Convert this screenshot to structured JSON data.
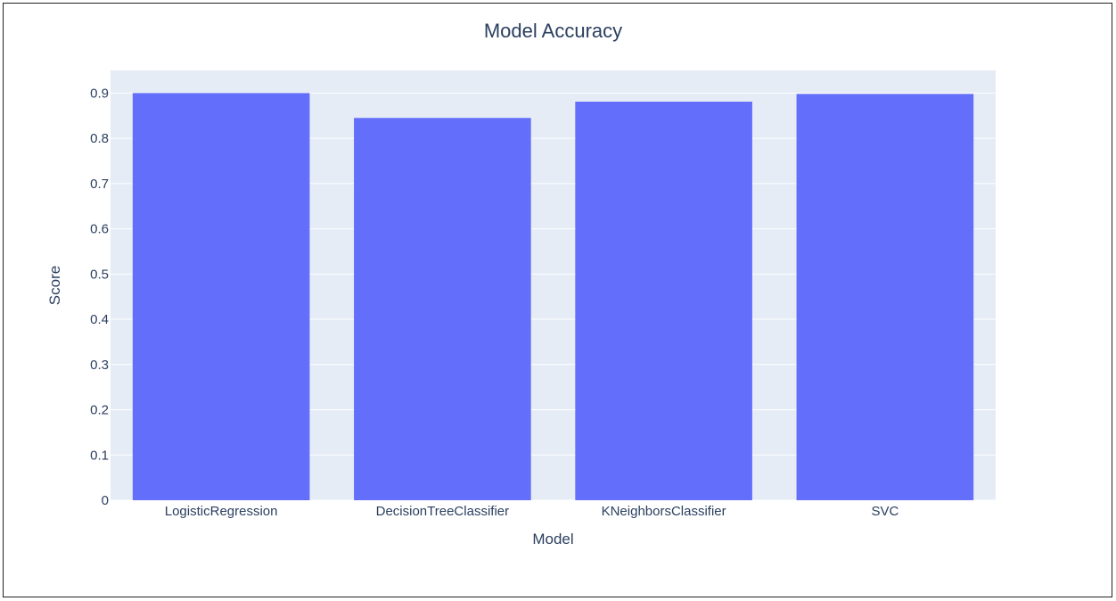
{
  "chart_data": {
    "type": "bar",
    "title": "Model Accuracy",
    "xlabel": "Model",
    "ylabel": "Score",
    "categories": [
      "LogisticRegression",
      "DecisionTreeClassifier",
      "KNeighborsClassifier",
      "SVC"
    ],
    "values": [
      0.9,
      0.845,
      0.881,
      0.898
    ],
    "ylim": [
      0,
      0.95
    ],
    "yticks": [
      0,
      0.1,
      0.2,
      0.3,
      0.4,
      0.5,
      0.6,
      0.7,
      0.8,
      0.9
    ],
    "ytick_labels": [
      "0",
      "0.1",
      "0.2",
      "0.3",
      "0.4",
      "0.5",
      "0.6",
      "0.7",
      "0.8",
      "0.9"
    ],
    "grid": true,
    "colors": {
      "bar": "#636efa",
      "plot_background": "#e5ecf6",
      "gridline": "#ffffff",
      "text": "#2a3f5f"
    }
  }
}
